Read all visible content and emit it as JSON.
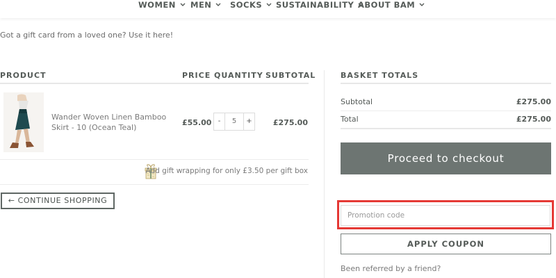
{
  "nav": {
    "items": [
      {
        "label": "WOMEN"
      },
      {
        "label": "MEN"
      },
      {
        "label": "SOCKS"
      },
      {
        "label": "SUSTAINABILITY"
      },
      {
        "label": "ABOUT BAM"
      }
    ]
  },
  "gift_card_message": "Got a gift card from a loved one? Use it here!",
  "cart": {
    "headers": {
      "product": "PRODUCT",
      "price": "PRICE",
      "quantity": "QUANTITY",
      "subtotal": "SUBTOTAL"
    },
    "items": [
      {
        "name": "Wander Woven Linen Bamboo Skirt - 10 (Ocean Teal)",
        "price": "£55.00",
        "quantity": "5",
        "qty_minus": "-",
        "qty_plus": "+",
        "subtotal": "£275.00",
        "image_icon": "skirt-product-image"
      }
    ],
    "gift_wrap_text": "Add gift wrapping for only £3.50 per gift box",
    "gift_wrap_icon": "gift-box-icon",
    "continue_label": "← CONTINUE SHOPPING"
  },
  "basket": {
    "title": "BASKET TOTALS",
    "subtotal_label": "Subtotal",
    "subtotal_value": "£275.00",
    "total_label": "Total",
    "total_value": "£275.00",
    "checkout_label": "Proceed to checkout",
    "promo_placeholder": "Promotion code",
    "promo_value": "",
    "apply_label": "APPLY COUPON",
    "referred_text": "Been referred by a friend?"
  },
  "colors": {
    "checkout_bg": "#6d7572",
    "highlight": "#e53935",
    "text_dark": "#555b58",
    "skirt": "#1f4a4f"
  }
}
